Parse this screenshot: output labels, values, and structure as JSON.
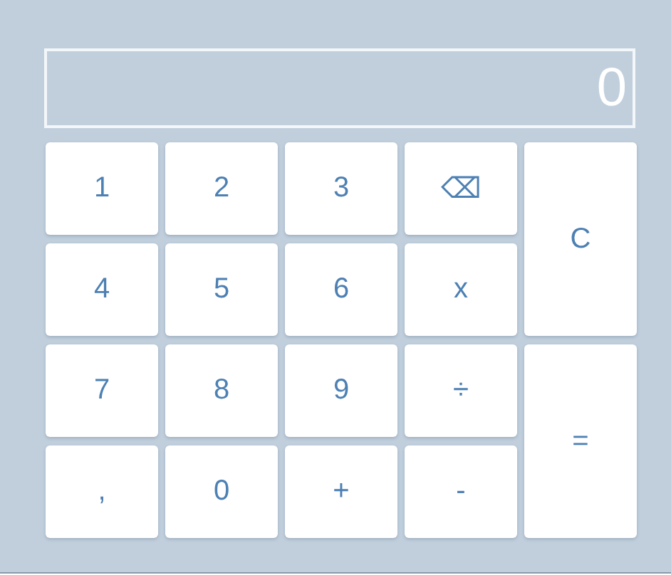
{
  "display": {
    "value": "0"
  },
  "keys": [
    {
      "label": "1",
      "kind": "key"
    },
    {
      "label": "2",
      "kind": "key"
    },
    {
      "label": "3",
      "kind": "key"
    },
    {
      "label": "⌫",
      "kind": "key"
    },
    {
      "label": "C",
      "kind": "tall"
    },
    {
      "label": "4",
      "kind": "key"
    },
    {
      "label": "5",
      "kind": "key"
    },
    {
      "label": "6",
      "kind": "key"
    },
    {
      "label": "x",
      "kind": "key"
    },
    {
      "label": "7",
      "kind": "key"
    },
    {
      "label": "8",
      "kind": "key"
    },
    {
      "label": "9",
      "kind": "key"
    },
    {
      "label": "÷",
      "kind": "key"
    },
    {
      "label": "=",
      "kind": "tall"
    },
    {
      "label": ",",
      "kind": "key"
    },
    {
      "label": "0",
      "kind": "key"
    },
    {
      "label": "+",
      "kind": "key"
    },
    {
      "label": "-",
      "kind": "key"
    }
  ]
}
